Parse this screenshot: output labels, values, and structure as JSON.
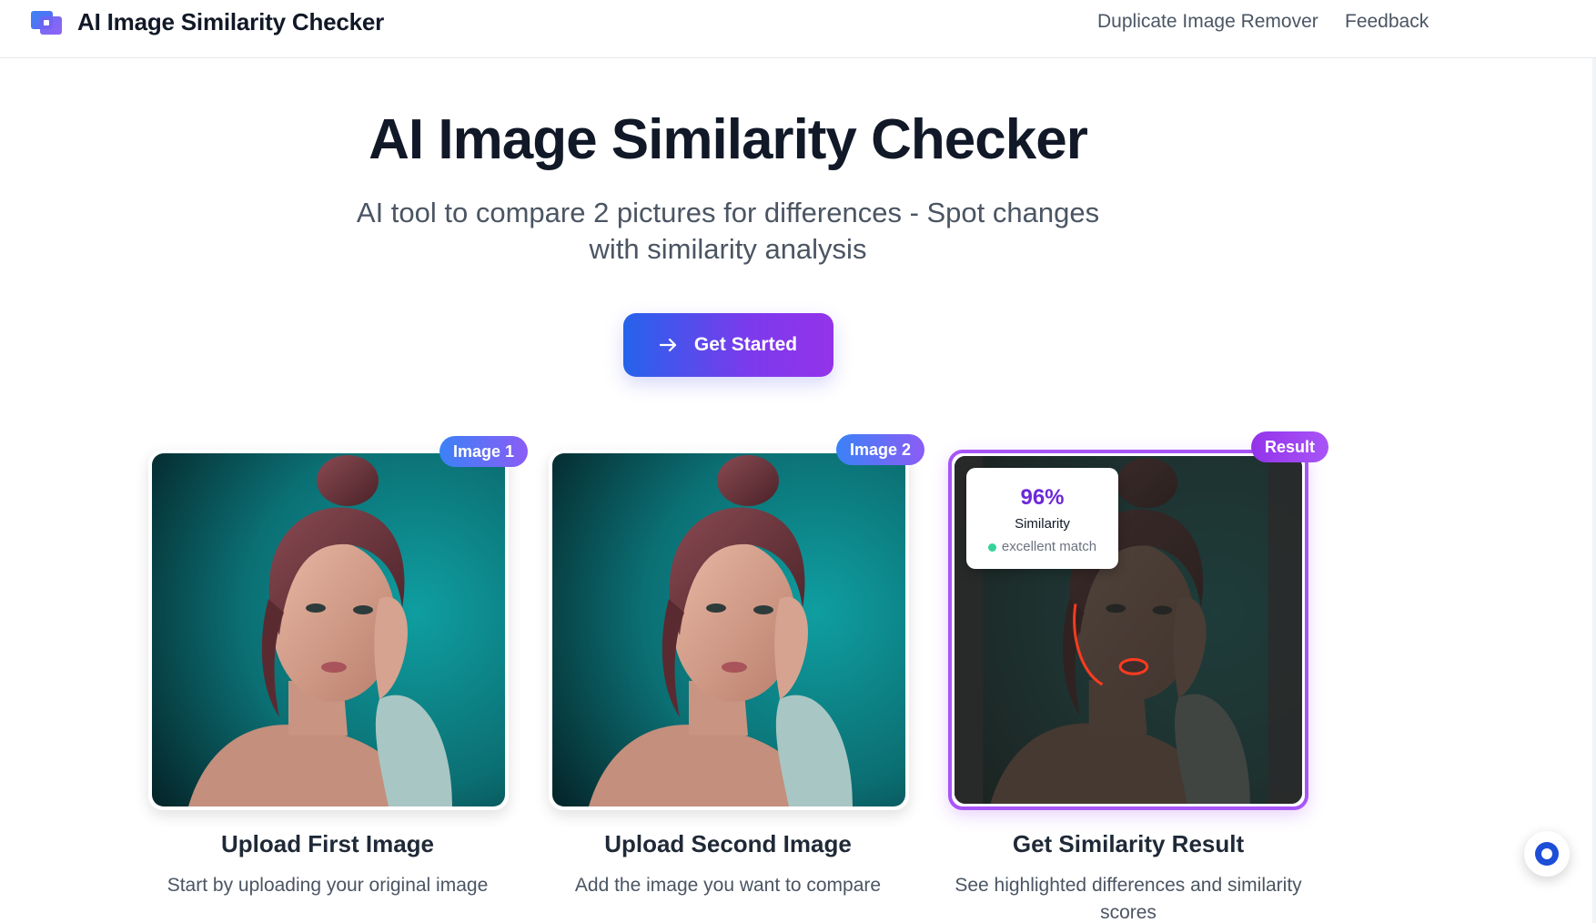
{
  "header": {
    "brand": "AI Image Similarity Checker",
    "nav": [
      "Duplicate Image Remover",
      "Feedback"
    ]
  },
  "hero": {
    "title": "AI Image Similarity Checker",
    "subtitle_line1": "AI tool to compare 2 pictures for differences - Spot changes",
    "subtitle_line2": "with similarity analysis",
    "cta_label": "Get Started",
    "cta_icon": "arrow-right-icon"
  },
  "cards": [
    {
      "badge": "Image 1",
      "title": "Upload First Image",
      "desc": "Start by uploading your original image"
    },
    {
      "badge": "Image 2",
      "title": "Upload Second Image",
      "desc": "Add the image you want to compare"
    },
    {
      "badge": "Result",
      "title": "Get Similarity Result",
      "desc_line1": "See highlighted differences and similarity",
      "desc_line2": "scores"
    }
  ],
  "result": {
    "percent": "96%",
    "label": "Similarity",
    "status": "excellent match"
  },
  "colors": {
    "accent_blue": "#2563eb",
    "accent_purple": "#9333ea",
    "result_border": "#a855f7",
    "match_dot": "#34d399"
  },
  "icons": {
    "logo": "logo-icon",
    "chat": "chat-bubble-icon"
  }
}
